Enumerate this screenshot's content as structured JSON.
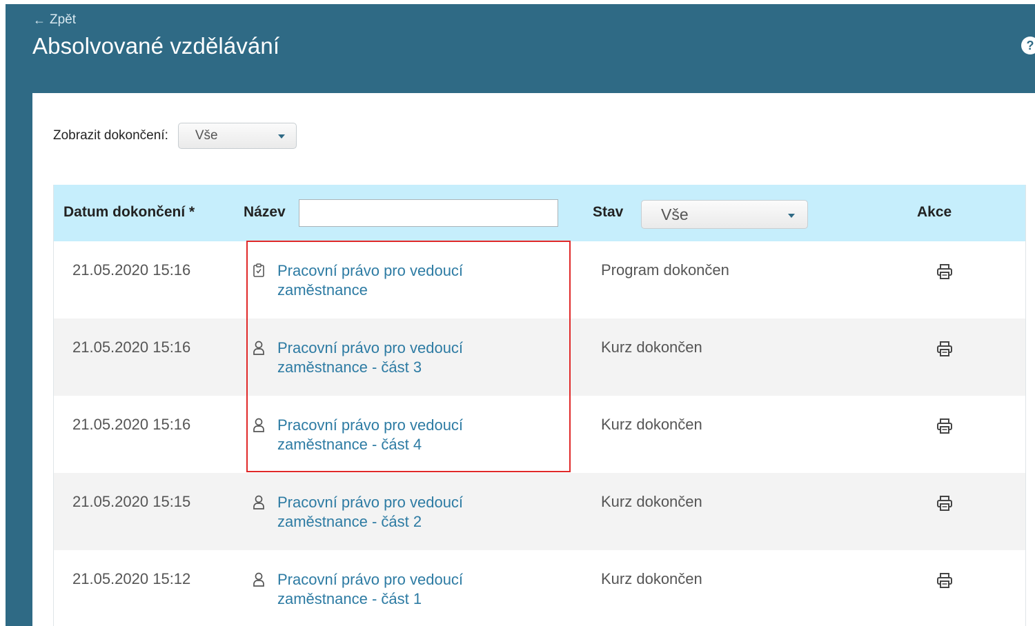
{
  "header": {
    "back_label": "Zpět",
    "title": "Absolvované vzdělávání",
    "help_label": "?"
  },
  "filter": {
    "label": "Zobrazit dokončení:",
    "value": "Vše"
  },
  "table": {
    "columns": {
      "date": "Datum dokončení *",
      "name": "Název",
      "status": "Stav",
      "actions": "Akce"
    },
    "name_filter_value": "",
    "status_filter_value": "Vše",
    "rows": [
      {
        "date": "21.05.2020 15:16",
        "icon": "clipboard-icon",
        "name": "Pracovní právo pro vedoucí zaměstnance",
        "status": "Program dokončen"
      },
      {
        "date": "21.05.2020 15:16",
        "icon": "user-icon",
        "name": "Pracovní právo pro vedoucí zaměstnance - část 3",
        "status": "Kurz dokončen"
      },
      {
        "date": "21.05.2020 15:16",
        "icon": "user-icon",
        "name": "Pracovní právo pro vedoucí zaměstnance - část 4",
        "status": "Kurz dokončen"
      },
      {
        "date": "21.05.2020 15:15",
        "icon": "user-icon",
        "name": "Pracovní právo pro vedoucí zaměstnance - část 2",
        "status": "Kurz dokončen"
      },
      {
        "date": "21.05.2020 15:12",
        "icon": "user-icon",
        "name": "Pracovní právo pro vedoucí zaměstnance - část 1",
        "status": "Kurz dokončen"
      }
    ]
  },
  "colors": {
    "header_bg": "#2f6a85",
    "table_header_bg": "#c6eefc",
    "link": "#2d7ba3",
    "highlight": "#e02828"
  }
}
